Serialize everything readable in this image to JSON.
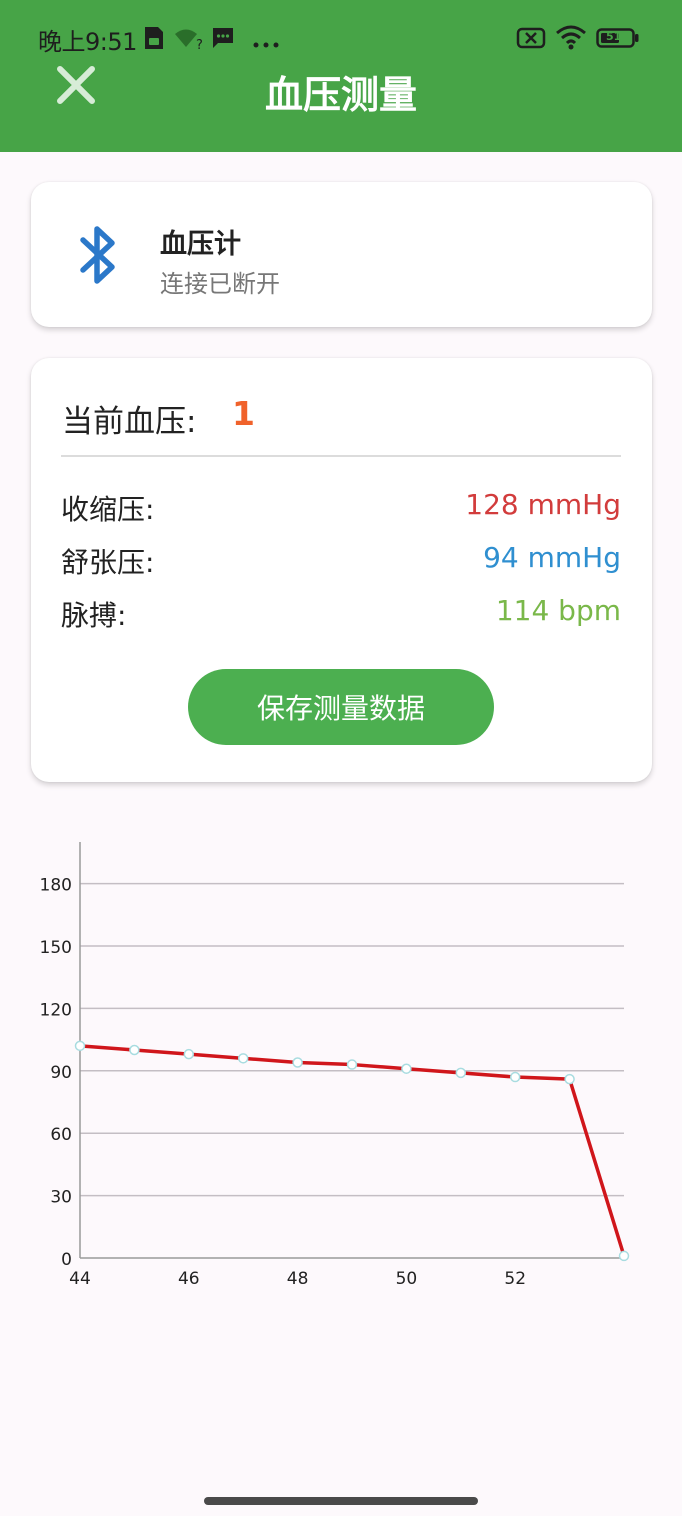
{
  "status_bar": {
    "time": "晚上9:51",
    "battery_level": "51"
  },
  "header": {
    "title": "血压测量",
    "close_icon": "close-icon",
    "background_color": "#47a447"
  },
  "device": {
    "icon": "bluetooth-icon",
    "name": "血压计",
    "status": "连接已断开"
  },
  "measurement": {
    "current_label": "当前血压:",
    "current_value": "1",
    "rows": [
      {
        "label": "收缩压:",
        "value": "128 mmHg",
        "color": "#d23c3c"
      },
      {
        "label": "舒张压:",
        "value": "94 mmHg",
        "color": "#2f8fd0"
      },
      {
        "label": "脉搏:",
        "value": "114 bpm",
        "color": "#7ab84a"
      }
    ],
    "save_button": "保存测量数据"
  },
  "chart_data": {
    "type": "line",
    "x": [
      44,
      45,
      46,
      47,
      48,
      49,
      50,
      51,
      52,
      53,
      54
    ],
    "series": [
      {
        "values": [
          102,
          100,
          98,
          96,
          94,
          93,
          91,
          89,
          87,
          86,
          1
        ],
        "color": "#d0161b"
      }
    ],
    "xticks": [
      44,
      46,
      48,
      50,
      52
    ],
    "yticks": [
      0,
      30,
      60,
      90,
      120,
      150,
      180
    ],
    "xlim": [
      44,
      54
    ],
    "ylim": [
      0,
      200
    ],
    "grid": true
  }
}
